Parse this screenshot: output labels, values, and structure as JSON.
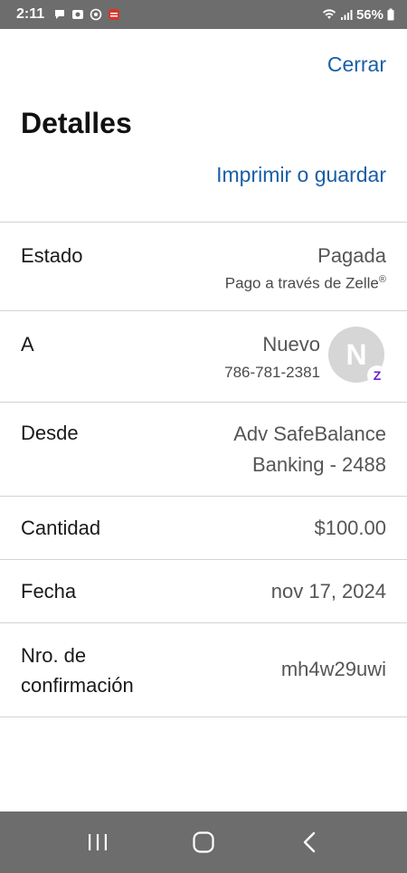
{
  "status_bar": {
    "time": "2:11",
    "battery": "56%"
  },
  "header": {
    "close_label": "Cerrar",
    "title": "Detalles",
    "print_label": "Imprimir o guardar"
  },
  "details": {
    "estado": {
      "label": "Estado",
      "value": "Pagada",
      "sub": "Pago a través de Zelle",
      "sub_mark": "®"
    },
    "a": {
      "label": "A",
      "name": "Nuevo",
      "phone": "786-781-2381",
      "avatar_letter": "N",
      "badge_letter": "Z"
    },
    "desde": {
      "label": "Desde",
      "line1": "Adv SafeBalance",
      "line2": "Banking - 2488"
    },
    "cantidad": {
      "label": "Cantidad",
      "value": "$100.00"
    },
    "fecha": {
      "label": "Fecha",
      "value": "nov 17, 2024"
    },
    "confirmacion": {
      "label_line1": "Nro. de",
      "label_line2": "confirmación",
      "value": "mh4w29uwi"
    }
  },
  "nav": {
    "recent_icon": "recent-apps-icon",
    "home_icon": "home-icon",
    "back_icon": "back-icon"
  },
  "colors": {
    "link": "#1a5ea6",
    "system_bar": "#6d6d6d",
    "zelle_purple": "#6d1ed4"
  }
}
